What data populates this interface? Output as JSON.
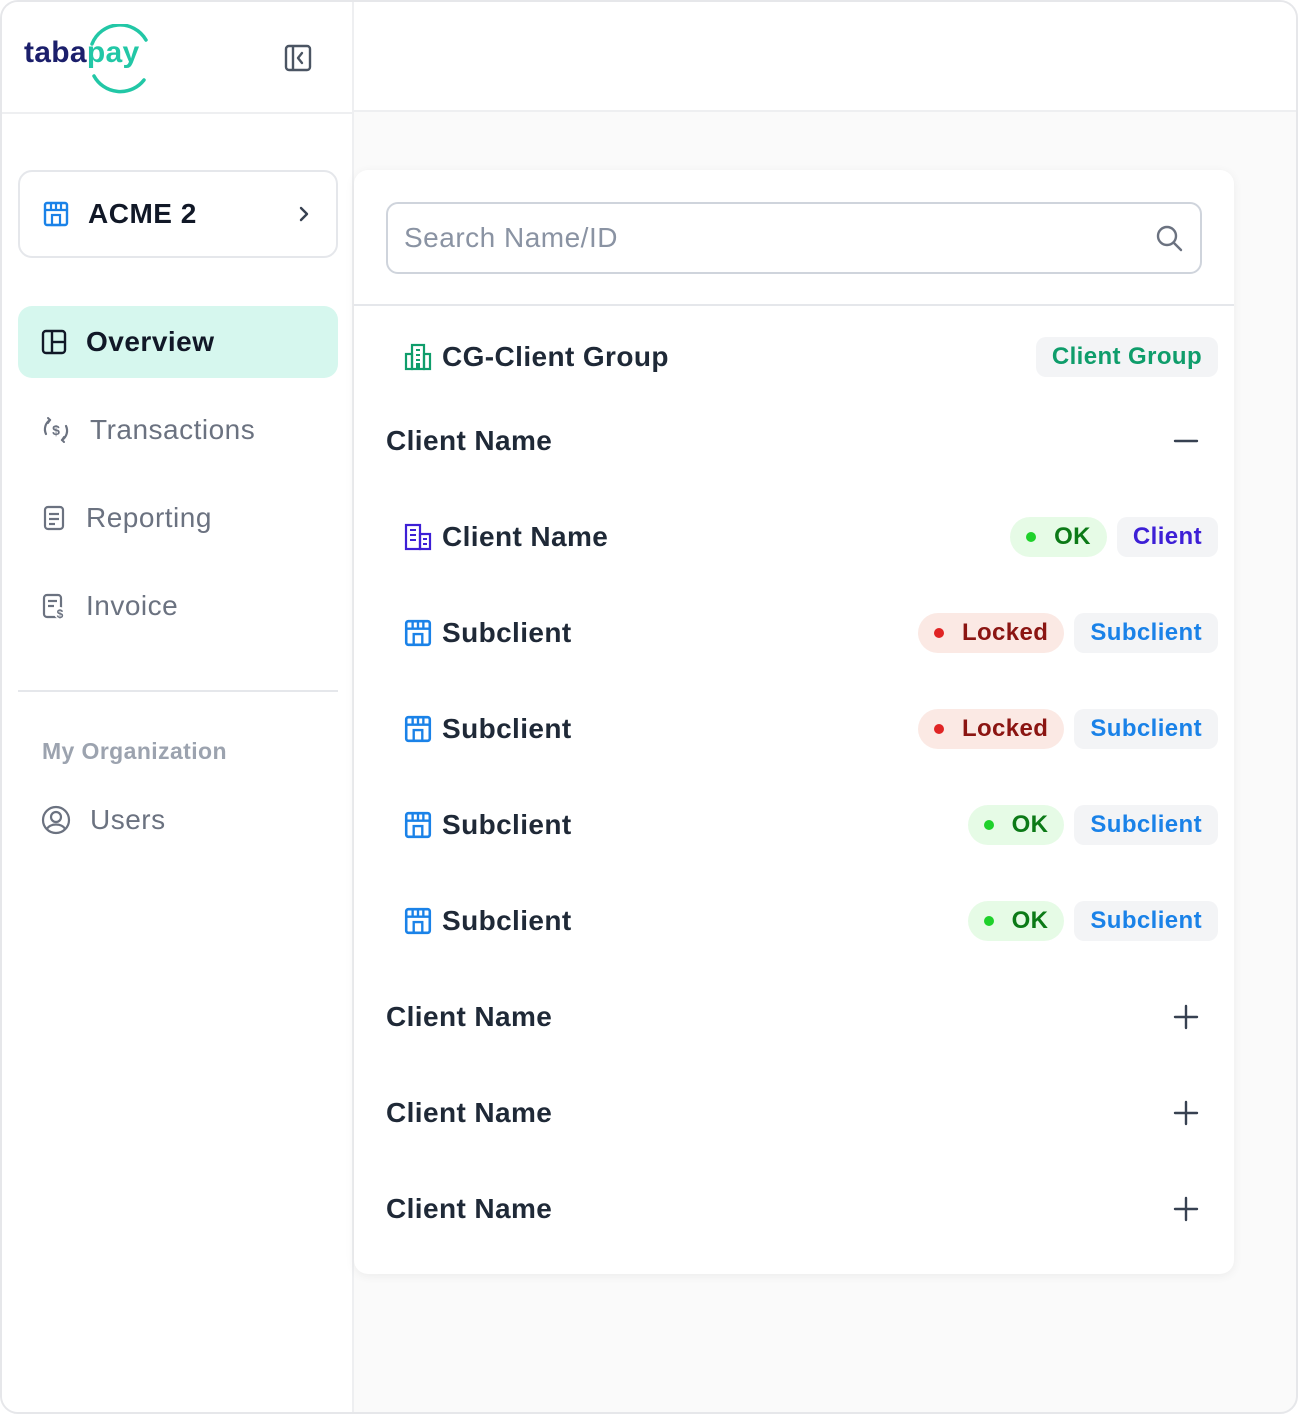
{
  "brand": {
    "logo_part1": "taba",
    "logo_part2": "pay"
  },
  "org_switcher": {
    "name": "ACME 2"
  },
  "nav": {
    "items": [
      {
        "label": "Overview"
      },
      {
        "label": "Transactions"
      },
      {
        "label": "Reporting"
      },
      {
        "label": "Invoice"
      }
    ],
    "section_title": "My Organization",
    "users_label": "Users"
  },
  "search": {
    "placeholder": "Search Name/ID",
    "value": ""
  },
  "tree": {
    "group": {
      "title": "CG-Client Group",
      "type": "Client Group"
    },
    "clients": [
      {
        "title": "Client Name",
        "expanded": true,
        "client": {
          "title": "Client Name",
          "status": "OK",
          "type": "Client"
        },
        "subclients": [
          {
            "title": "Subclient",
            "status": "Locked",
            "type": "Subclient"
          },
          {
            "title": "Subclient",
            "status": "Locked",
            "type": "Subclient"
          },
          {
            "title": "Subclient",
            "status": "OK",
            "type": "Subclient"
          },
          {
            "title": "Subclient",
            "status": "OK",
            "type": "Subclient"
          }
        ]
      },
      {
        "title": "Client Name",
        "expanded": false
      },
      {
        "title": "Client Name",
        "expanded": false
      },
      {
        "title": "Client Name",
        "expanded": false
      }
    ]
  },
  "colors": {
    "accent_green": "#22c7a6",
    "active_nav_bg": "#d6f7ee",
    "ok": "#1fd12b",
    "locked": "#e02424",
    "subclient_blue": "#1a82e8",
    "client_purple": "#3d1fd6"
  }
}
